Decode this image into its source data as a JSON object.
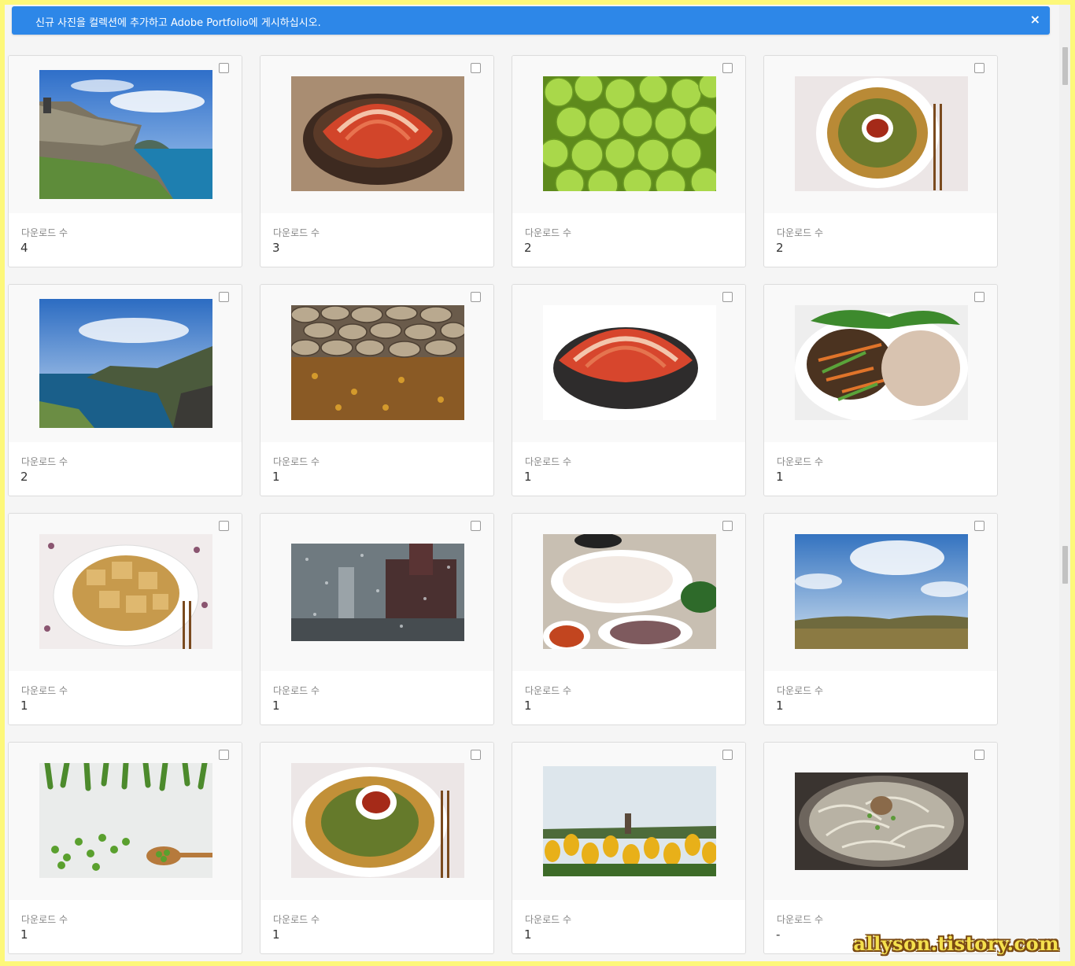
{
  "banner": {
    "message": "신규 사진을 컬렉션에 추가하고 Adobe Portfolio에 게시하십시오.",
    "close": "×"
  },
  "download_label": "다운로드 수",
  "cards": [
    {
      "subject": "jeju-coastal-cliff",
      "downloads": "4"
    },
    {
      "subject": "kimchi-bowl",
      "downloads": "3"
    },
    {
      "subject": "green-plums",
      "downloads": "2"
    },
    {
      "subject": "zucchini-pancake",
      "downloads": "2"
    },
    {
      "subject": "jeju-coastline",
      "downloads": "2"
    },
    {
      "subject": "stone-wall-leaves",
      "downloads": "1"
    },
    {
      "subject": "kimchi-bowl-white",
      "downloads": "1"
    },
    {
      "subject": "bulgogi-rice-plate",
      "downloads": "1"
    },
    {
      "subject": "injeolmi-rice-cake",
      "downloads": "1"
    },
    {
      "subject": "rainy-window-city",
      "downloads": "1"
    },
    {
      "subject": "raw-fish-sashimi",
      "downloads": "1"
    },
    {
      "subject": "royal-tombs-sky",
      "downloads": "1"
    },
    {
      "subject": "green-peas",
      "downloads": "1"
    },
    {
      "subject": "zucchini-pancake-2",
      "downloads": "1"
    },
    {
      "subject": "yellow-tulip-field",
      "downloads": "1"
    },
    {
      "subject": "bean-sprout-soup",
      "downloads": "-"
    }
  ],
  "watermark": "allyson.tistory.com"
}
